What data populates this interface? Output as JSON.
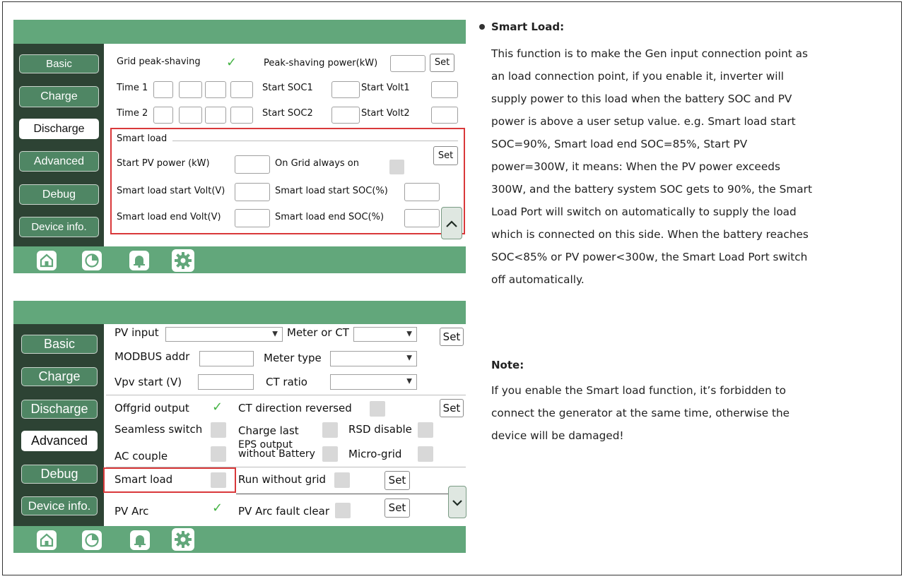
{
  "panel1": {
    "sidebar": [
      "Basic",
      "Charge",
      "Discharge",
      "Advanced",
      "Debug",
      "Device info."
    ],
    "active": "Discharge",
    "peak_label": "Grid peak-shaving",
    "peak_power_label": "Peak-shaving power(kW)",
    "set": "Set",
    "time1": "Time 1",
    "time2": "Time 2",
    "start_soc1": "Start SOC1",
    "start_volt1": "Start Volt1",
    "start_soc2": "Start SOC2",
    "start_volt2": "Start Volt2",
    "smart_load_title": "Smart load",
    "start_pv": "Start PV power (kW)",
    "on_grid": "On Grid always on",
    "sl_start_volt": "Smart load start Volt(V)",
    "sl_start_soc": "Smart load start SOC(%)",
    "sl_end_volt": "Smart load end Volt(V)",
    "sl_end_soc": "Smart load end SOC(%)",
    "scroll_icon": "chevron-up-icon"
  },
  "panel2": {
    "sidebar": [
      "Basic",
      "Charge",
      "Discharge",
      "Advanced",
      "Debug",
      "Device info."
    ],
    "active": "Advanced",
    "pv_input": "PV input",
    "meter_or_ct": "Meter or CT",
    "set": "Set",
    "modbus": "MODBUS addr",
    "meter_type": "Meter type",
    "vpv_start": "Vpv start (V)",
    "ct_ratio": "CT ratio",
    "offgrid": "Offgrid output",
    "ct_dir": "CT direction reversed",
    "seamless": "Seamless switch",
    "charge_last": "Charge last",
    "rsd": "RSD disable",
    "ac_couple": "AC couple",
    "eps1": "EPS output",
    "eps2": "without Battery",
    "micro_grid": "Micro-grid",
    "smart_load": "Smart load",
    "run_wo_grid": "Run without grid",
    "pv_arc": "PV Arc",
    "pv_arc_clear": "PV Arc fault clear",
    "scroll_icon": "chevron-down-icon"
  },
  "nav_icons": [
    "home-icon",
    "pie-chart-icon",
    "bell-icon",
    "gear-icon"
  ],
  "desc": {
    "heading": "Smart Load:",
    "lines": [
      "This function is to make the Gen input connection point as",
      "an load connection point, if you enable it, inverter will",
      "supply power to this load when the battery SOC and PV",
      "power is above a user setup value. e.g. Smart load start",
      "SOC=90%, Smart load end SOC=85%, Start PV",
      "power=300W, it means: When the PV power exceeds",
      "300W, and the battery system SOC gets to 90%, the Smart",
      "Load Port will switch on automatically to supply the load",
      "which is connected on this side. When the battery reaches",
      "SOC<85% or PV power<300w, the Smart Load Port switch",
      "off automatically."
    ],
    "note_heading": "Note:",
    "note_lines": [
      "If you enable the Smart load function, it’s forbidden to",
      "connect the generator at the same time, otherwise the",
      "device will be damaged!"
    ]
  },
  "colors": {
    "bar": "#62a77b",
    "sidebar": "#2d4334",
    "button": "#4f8664",
    "highlight": "#d9383a"
  }
}
